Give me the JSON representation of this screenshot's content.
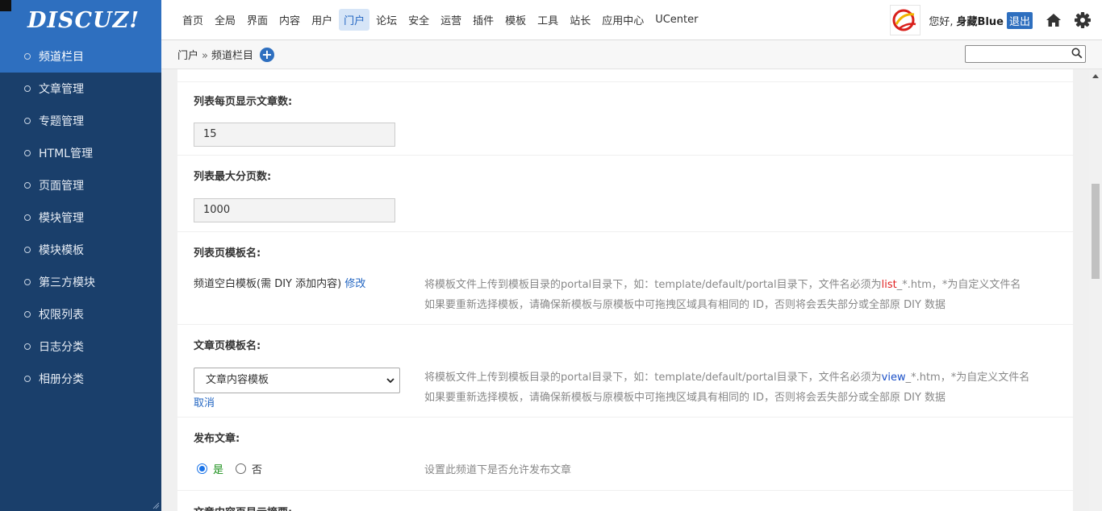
{
  "sidebar": {
    "logo": "DISCUZ!",
    "items": [
      {
        "label": "频道栏目"
      },
      {
        "label": "文章管理"
      },
      {
        "label": "专题管理"
      },
      {
        "label": "HTML管理"
      },
      {
        "label": "页面管理"
      },
      {
        "label": "模块管理"
      },
      {
        "label": "模块模板"
      },
      {
        "label": "第三方模块"
      },
      {
        "label": "权限列表"
      },
      {
        "label": "日志分类"
      },
      {
        "label": "相册分类"
      }
    ]
  },
  "topnav": {
    "items": [
      "首页",
      "全局",
      "界面",
      "内容",
      "用户",
      "门户",
      "论坛",
      "安全",
      "运营",
      "插件",
      "模板",
      "工具",
      "站长",
      "应用中心",
      "UCenter"
    ],
    "active_index": 5
  },
  "user": {
    "greeting": "您好,",
    "name": "身藏Blue",
    "logout": "退出",
    "icons": [
      "home-icon",
      "gear-icon"
    ]
  },
  "breadcrumb": {
    "root": "门户",
    "separator": "»",
    "current": "频道栏目"
  },
  "search": {
    "value": ""
  },
  "form": {
    "per_page": {
      "label": "列表每页显示文章数:",
      "value": "15"
    },
    "max_pages": {
      "label": "列表最大分页数:",
      "value": "1000"
    },
    "list_tpl": {
      "label": "列表页模板名:",
      "name": "频道空白模板(需 DIY 添加内容)",
      "edit": "修改",
      "note_pre": "将模板文件上传到模板目录的portal目录下，如：template/default/portal目录下，文件名必须为",
      "note_hl": "list",
      "note_post": "_*.htm，*为自定义文件名",
      "note2": "如果要重新选择模板，请确保新模板与原模板中可拖拽区域具有相同的 ID，否则将会丢失部分或全部原 DIY 数据"
    },
    "article_tpl": {
      "label": "文章页模板名:",
      "selected": "文章内容模板",
      "cancel": "取消",
      "note_pre": "将模板文件上传到模板目录的portal目录下，如：template/default/portal目录下，文件名必须为",
      "note_hl": "view",
      "note_post": "_*.htm，*为自定义文件名",
      "note2": "如果要重新选择模板，请确保新模板与原模板中可拖拽区域具有相同的 ID，否则将会丢失部分或全部原 DIY 数据"
    },
    "publish": {
      "label": "发布文章:",
      "yes": "是",
      "no": "否",
      "selected": "yes",
      "note": "设置此频道下是否允许发布文章"
    },
    "next_label": "文章内容页显示摘要:"
  },
  "colors": {
    "accent": "#2e6fbf",
    "sidebar_bg": "#1a3f6b"
  }
}
